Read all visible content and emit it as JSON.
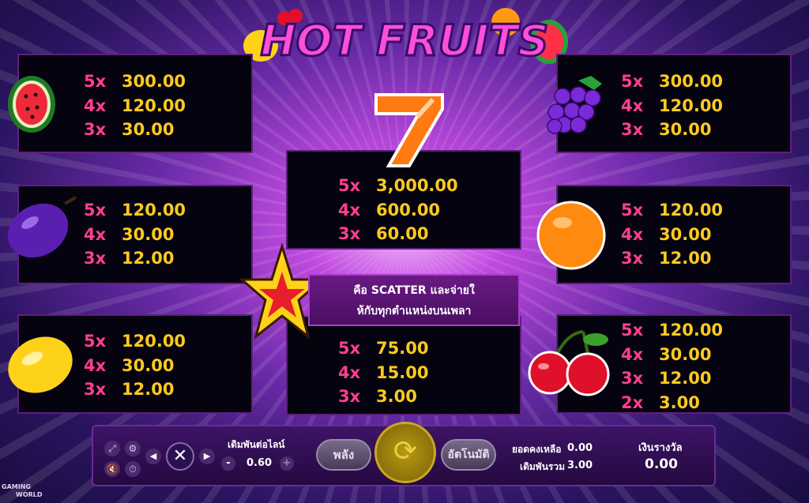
{
  "title": {
    "text": "HOT FRUITS"
  },
  "symbols": {
    "watermelon": {
      "icon": "watermelon-icon",
      "pays": [
        {
          "m": "5x",
          "v": "300.00"
        },
        {
          "m": "4x",
          "v": "120.00"
        },
        {
          "m": "3x",
          "v": "30.00"
        }
      ]
    },
    "plum": {
      "icon": "plum-icon",
      "pays": [
        {
          "m": "5x",
          "v": "120.00"
        },
        {
          "m": "4x",
          "v": "30.00"
        },
        {
          "m": "3x",
          "v": "12.00"
        }
      ]
    },
    "lemon": {
      "icon": "lemon-icon",
      "pays": [
        {
          "m": "5x",
          "v": "120.00"
        },
        {
          "m": "4x",
          "v": "30.00"
        },
        {
          "m": "3x",
          "v": "12.00"
        }
      ]
    },
    "seven": {
      "icon": "seven-icon",
      "pays": [
        {
          "m": "5x",
          "v": "3,000.00"
        },
        {
          "m": "4x",
          "v": "600.00"
        },
        {
          "m": "3x",
          "v": "60.00"
        }
      ]
    },
    "star": {
      "icon": "star-scatter-icon",
      "pays": [
        {
          "m": "5x",
          "v": "75.00"
        },
        {
          "m": "4x",
          "v": "15.00"
        },
        {
          "m": "3x",
          "v": "3.00"
        }
      ]
    },
    "grapes": {
      "icon": "grapes-icon",
      "pays": [
        {
          "m": "5x",
          "v": "300.00"
        },
        {
          "m": "4x",
          "v": "120.00"
        },
        {
          "m": "3x",
          "v": "30.00"
        }
      ]
    },
    "orange": {
      "icon": "orange-icon",
      "pays": [
        {
          "m": "5x",
          "v": "120.00"
        },
        {
          "m": "4x",
          "v": "30.00"
        },
        {
          "m": "3x",
          "v": "12.00"
        }
      ]
    },
    "cherry": {
      "icon": "cherry-icon",
      "pays": [
        {
          "m": "5x",
          "v": "120.00"
        },
        {
          "m": "4x",
          "v": "30.00"
        },
        {
          "m": "3x",
          "v": "12.00"
        },
        {
          "m": "2x",
          "v": "3.00"
        }
      ]
    }
  },
  "scatter_text": {
    "line1": "คือ SCATTER และจ่ายใ",
    "line2": "ห้กับทุกตำแหน่งบนเพลา"
  },
  "controls": {
    "bet_per_line_label": "เดิมพันต่อไลน์",
    "bet_per_line_value": "0.60",
    "minus": "-",
    "plus": "+",
    "power_label": "พลัง",
    "auto_label": "อัตโนมัติ",
    "balance_label": "ยอดคงเหลือ",
    "balance_value": "0.00",
    "total_bet_label": "เดิมพันรวม",
    "total_bet_value": "3.00",
    "win_label": "เงินรางวัล",
    "win_value": "0.00"
  },
  "brand": {
    "line1": "GAMING",
    "line2": "WORLD"
  },
  "colors": {
    "multiplier": "#ff3f8e",
    "value": "#ffca1e",
    "panel": "#05030f"
  }
}
